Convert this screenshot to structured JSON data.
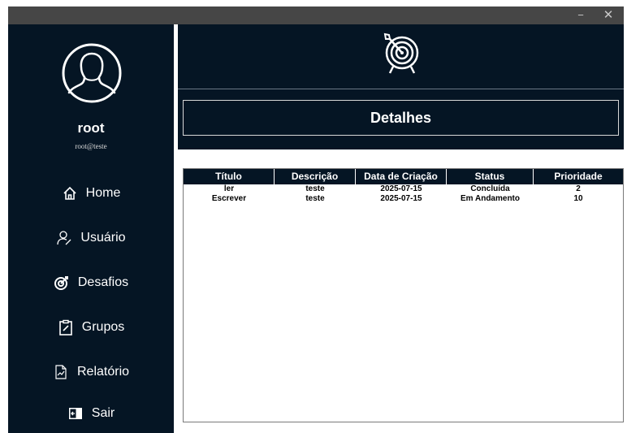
{
  "window": {
    "minimize_glyph": "−",
    "close_glyph": "✕"
  },
  "sidebar": {
    "username": "root",
    "email": "root@teste",
    "nav": [
      {
        "label": "Home",
        "icon": "home-icon"
      },
      {
        "label": "Usuário",
        "icon": "user-icon"
      },
      {
        "label": "Desafios",
        "icon": "target-icon"
      },
      {
        "label": "Grupos",
        "icon": "clipboard-icon"
      },
      {
        "label": "Relatório",
        "icon": "report-icon"
      },
      {
        "label": "Sair",
        "icon": "exit-icon"
      }
    ]
  },
  "header": {
    "title": "Detalhes",
    "logo_icon": "target-arrow-icon"
  },
  "table": {
    "columns": [
      "Título",
      "Descrição",
      "Data de Criação",
      "Status",
      "Prioridade"
    ],
    "rows": [
      [
        "ler",
        "teste",
        "2025-07-15",
        "Concluída",
        "2"
      ],
      [
        "Escrever",
        "teste",
        "2025-07-15",
        "Em Andamento",
        "10"
      ]
    ]
  },
  "colors": {
    "navy": "#051524",
    "titlebar": "#464646",
    "text": "#ffffff"
  }
}
